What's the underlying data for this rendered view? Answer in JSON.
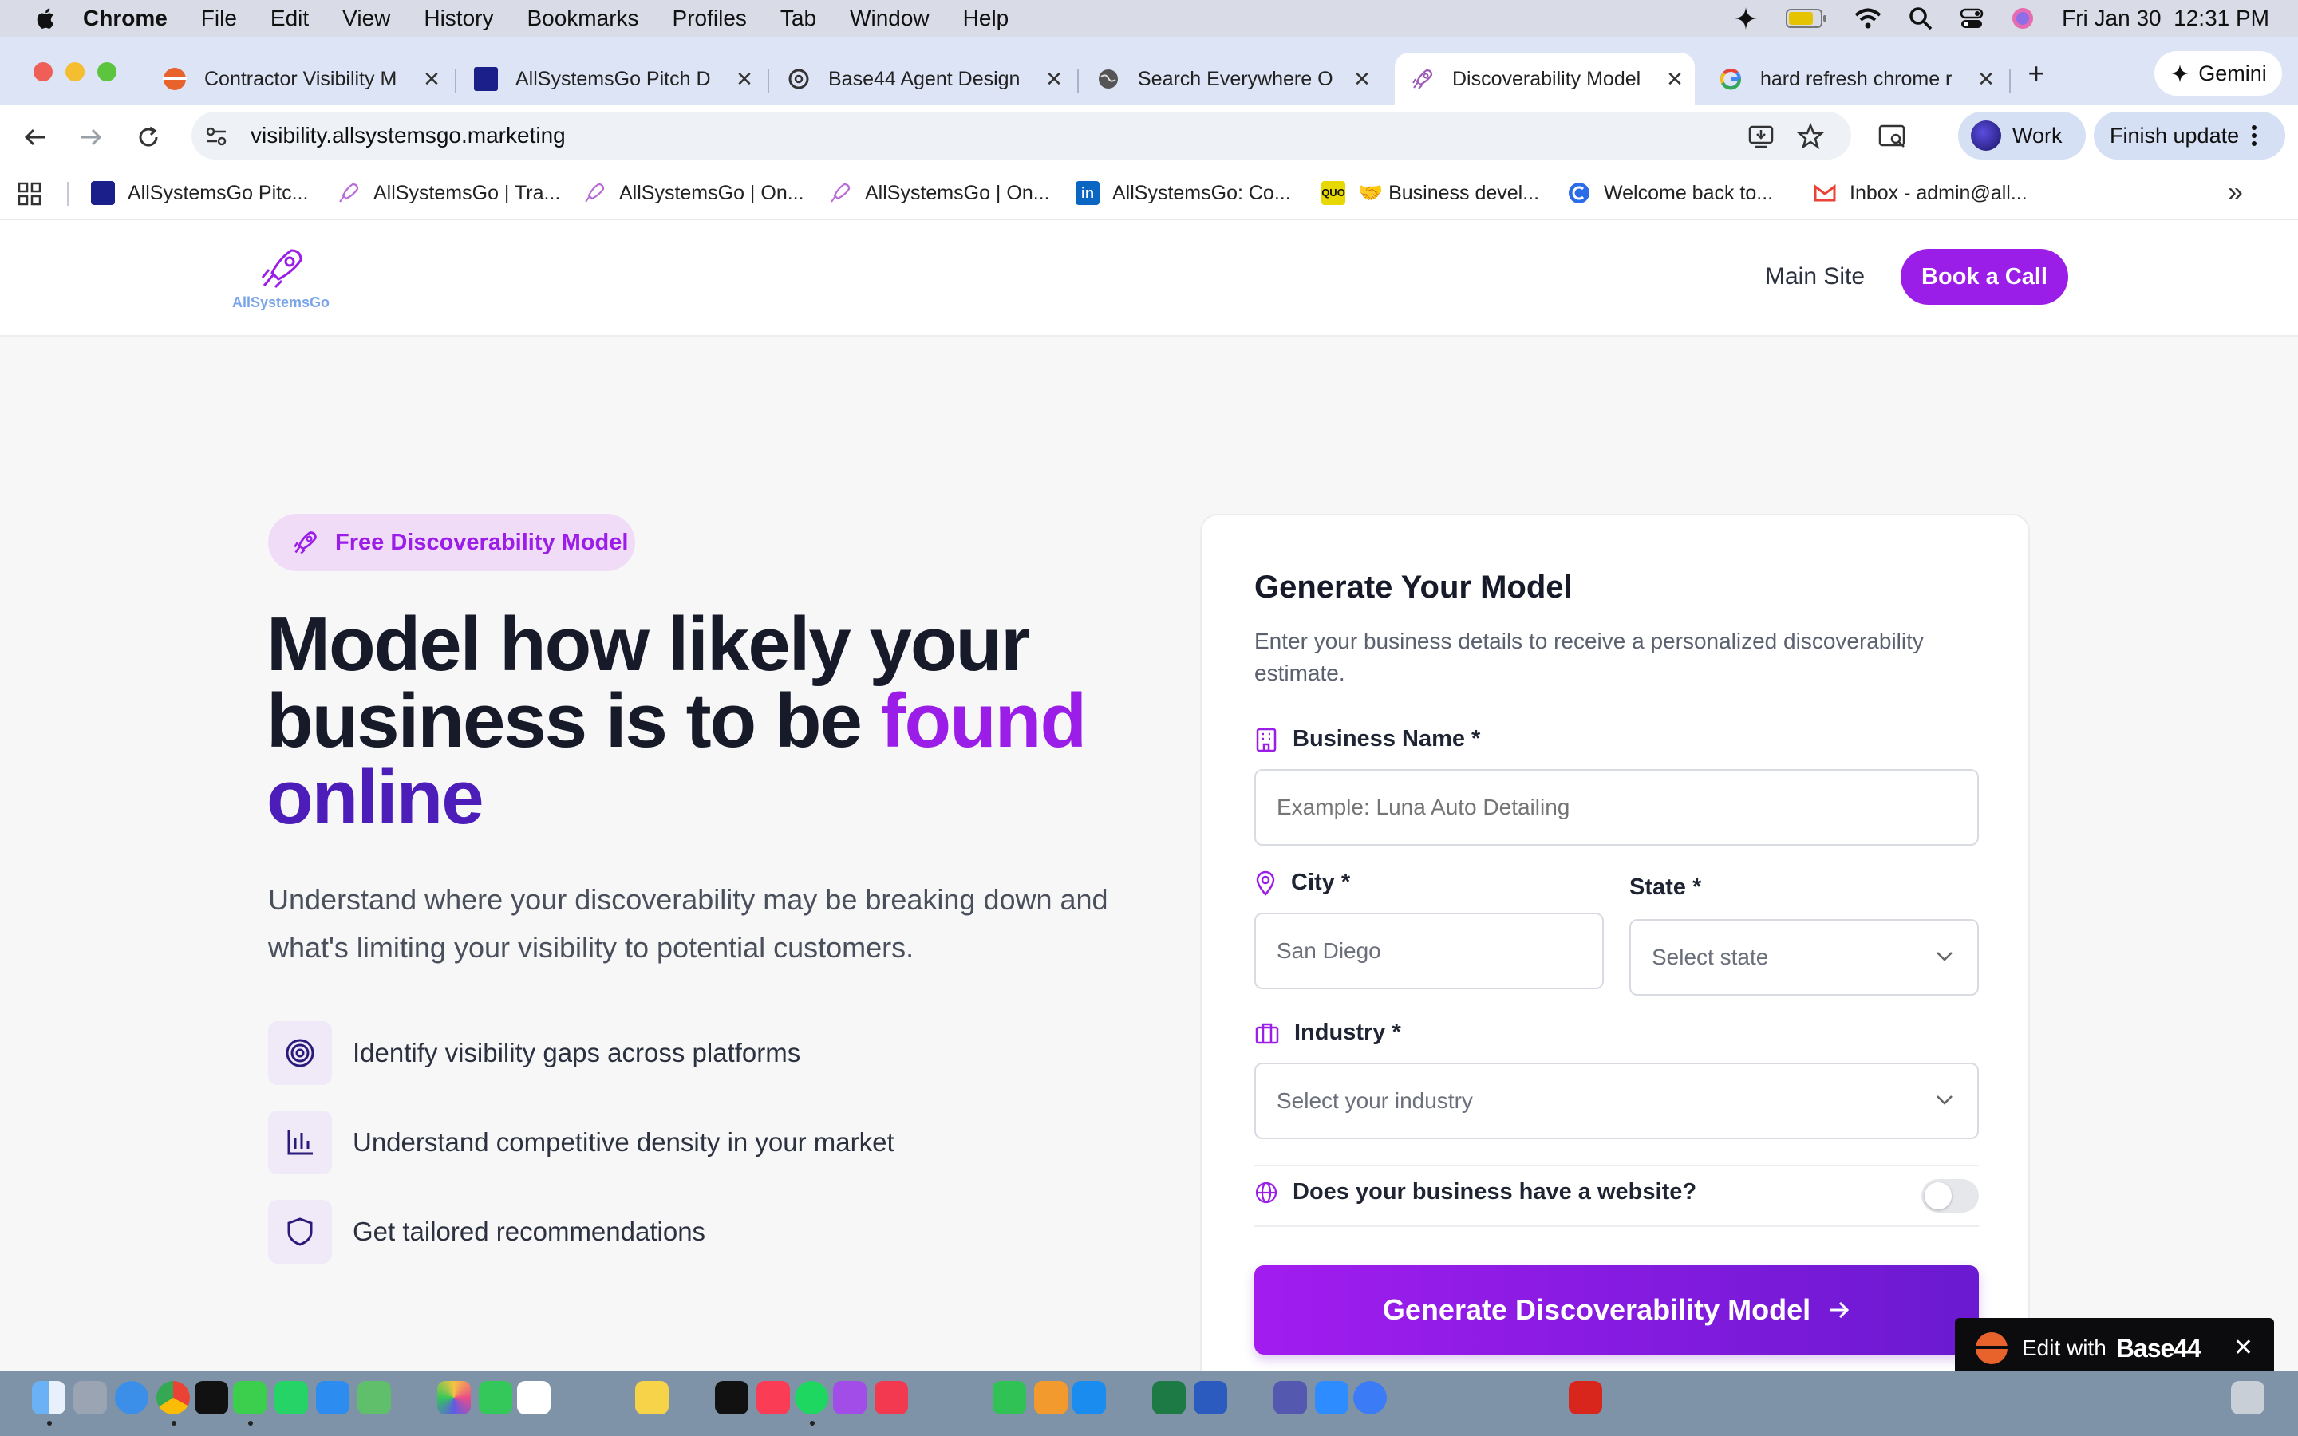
{
  "menubar": {
    "items": [
      "Chrome",
      "File",
      "Edit",
      "View",
      "History",
      "Bookmarks",
      "Profiles",
      "Tab",
      "Window",
      "Help"
    ],
    "clock": "Fri Jan 30  12:31 PM"
  },
  "tabs": [
    {
      "title": "Contractor Visibility M",
      "color": "#e8622c"
    },
    {
      "title": "AllSystemsGo Pitch D",
      "color": "#1b1f8a"
    },
    {
      "title": "Base44 Agent Design",
      "color": "#333333"
    },
    {
      "title": "Search Everywhere O",
      "color": "#555555"
    },
    {
      "title": "Discoverability Model",
      "color": "#9b59b6"
    },
    {
      "title": "hard refresh chrome r",
      "color": "#4285f4"
    }
  ],
  "toolbar": {
    "url": "visibility.allsystemsgo.marketing",
    "gemini": "Gemini",
    "profile": "Work",
    "finish_update": "Finish update"
  },
  "bookmarks": [
    {
      "label": "AllSystemsGo Pitc...",
      "color": "#1b1f8a"
    },
    {
      "label": "AllSystemsGo | Tra...",
      "color": "#b86bd6"
    },
    {
      "label": "AllSystemsGo | On...",
      "color": "#b86bd6"
    },
    {
      "label": "AllSystemsGo | On...",
      "color": "#b86bd6"
    },
    {
      "label": "AllSystemsGo: Co...",
      "color": "#0a66c2"
    },
    {
      "label": "🤝 Business devel...",
      "color": "#e6d800"
    },
    {
      "label": "Welcome back to...",
      "color": "#2b6de8"
    },
    {
      "label": "Inbox - admin@all...",
      "color": "#ea4335"
    }
  ],
  "site": {
    "logo_text": "AllSystemsGo",
    "nav_main": "Main Site",
    "nav_cta": "Book a Call"
  },
  "hero": {
    "badge": "Free Discoverability Model",
    "h1_line1": "Model how likely your",
    "h1_line2a": "business is to be ",
    "h1_line2b": "found",
    "h1_line3": "online",
    "sub": "Understand where your discoverability may be breaking down and what's limiting your visibility to potential customers.",
    "features": [
      "Identify visibility gaps across platforms",
      "Understand competitive density in your market",
      "Get tailored recommendations"
    ]
  },
  "form": {
    "title": "Generate Your Model",
    "desc": "Enter your business details to receive a personalized discoverability estimate.",
    "business_label": "Business Name *",
    "business_placeholder": "Example: Luna Auto Detailing",
    "city_label": "City *",
    "city_value": "San Diego",
    "state_label": "State *",
    "state_value": "Select state",
    "industry_label": "Industry *",
    "industry_value": "Select your industry",
    "website_label": "Does your business have a website?",
    "submit": "Generate Discoverability Model"
  },
  "base44": {
    "prefix": "Edit with",
    "brand": "Base44"
  },
  "colors": {
    "accent": "#9b1de8",
    "accent_dark": "#4c1db8",
    "heading": "#161a29"
  }
}
